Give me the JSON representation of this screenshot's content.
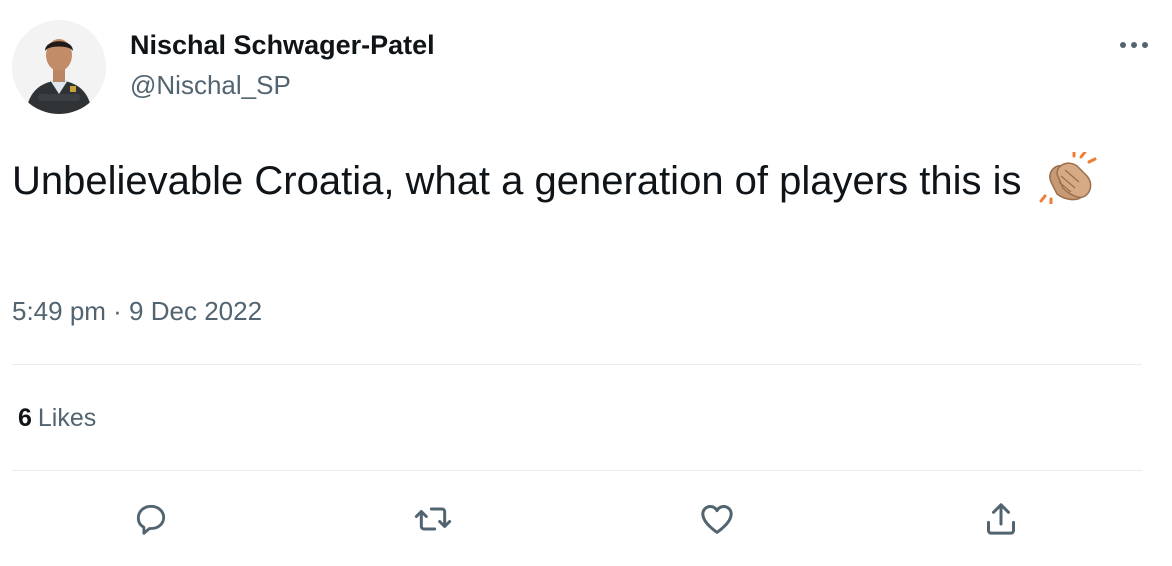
{
  "tweet": {
    "author": {
      "display_name": "Nischal Schwager-Patel",
      "handle": "@Nischal_SP",
      "avatar": "profile-photo"
    },
    "text": "Unbelievable Croatia, what a generation of players this is",
    "emoji": "clapping-hands",
    "timestamp": "5:49 pm · 9 Dec 2022",
    "likes": {
      "count": "6",
      "label": "Likes"
    },
    "actions": [
      "reply-icon",
      "retweet-icon",
      "like-icon",
      "share-icon"
    ],
    "colors": {
      "text": "#0f1419",
      "secondary": "#536471",
      "divider": "#e6ecf0"
    }
  }
}
